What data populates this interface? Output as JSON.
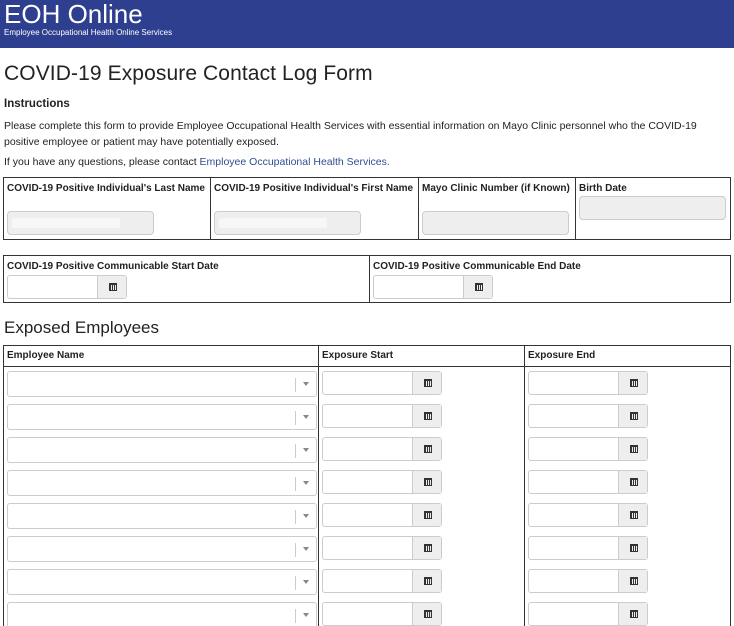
{
  "header": {
    "app_title": "EOH Online",
    "app_subtitle": "Employee Occupational Health Online Services",
    "brand_color": "#2e3f8f"
  },
  "page": {
    "title": "COVID-19 Exposure Contact Log Form",
    "instructions_heading": "Instructions",
    "instructions_text": "Please complete this form to provide Employee Occupational Health Services with essential information on Mayo Clinic personnel who the COVID-19 positive employee or patient may have potentially exposed.",
    "contact_prefix": "If you have any questions, please contact ",
    "contact_link": "Employee Occupational Health Services."
  },
  "positive_individual": {
    "last_name_label": "COVID-19 Positive Individual's Last Name",
    "first_name_label": "COVID-19 Positive Individual's First Name",
    "clinic_number_label": "Mayo Clinic Number (if Known)",
    "birth_date_label": "Birth Date"
  },
  "communicable": {
    "start_label": "COVID-19 Positive Communicable Start Date",
    "end_label": "COVID-19 Positive Communicable End Date"
  },
  "exposed": {
    "section_title": "Exposed Employees",
    "col_employee": "Employee Name",
    "col_start": "Exposure Start",
    "col_end": "Exposure End",
    "row_count": 8
  },
  "icons": {
    "calendar": "calendar-icon",
    "dropdown": "chevron-down-icon"
  }
}
